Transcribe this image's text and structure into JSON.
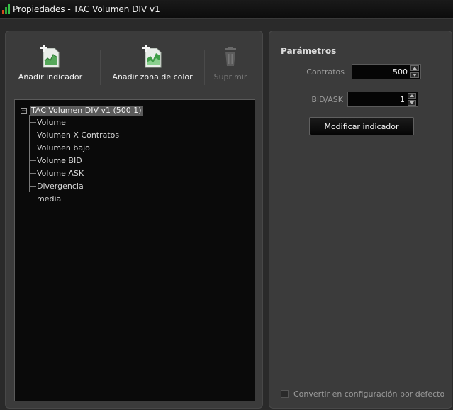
{
  "window": {
    "title": "Propiedades - TAC Volumen DIV v1",
    "icon_colors": [
      "#d24a1f",
      "#2da83a",
      "#38c04a"
    ]
  },
  "toolbar": {
    "add_indicator": "Añadir indicador",
    "add_color_zone": "Añadir zona de color",
    "delete": "Suprimir",
    "delete_enabled": false,
    "icons": {
      "add_indicator": "add-chart-icon",
      "add_color_zone": "add-area-chart-icon",
      "delete": "trash-icon"
    }
  },
  "tree": {
    "expander_symbol": "−",
    "root": "TAC Volumen DIV v1 (500 1)",
    "children": [
      "Volume",
      "Volumen X Contratos",
      "Volumen bajo",
      "Volume BID",
      "Volume ASK",
      "Divergencia",
      "media"
    ]
  },
  "parameters": {
    "title": "Parámetros",
    "contratos_label": "Contratos",
    "contratos_value": "500",
    "bidask_label": "BID/ASK",
    "bidask_value": "1",
    "modify_button": "Modificar indicador"
  },
  "default_config": {
    "label": "Convertir en configuración por defecto",
    "checked": false
  }
}
